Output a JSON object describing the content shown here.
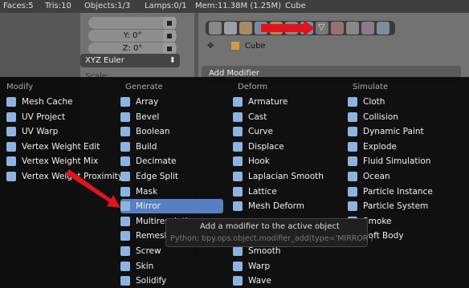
{
  "header": {
    "faces": "Faces:5",
    "tris": "Tris:10",
    "objects": "Objects:1/3",
    "lamps": "Lamps:0/1",
    "mem": "Mem:11.38M (1.25M)",
    "object_name": "Cube"
  },
  "transform": {
    "rot_y": "Y: 0°",
    "rot_z": "Z: 0°",
    "rotation_mode": "XYZ Euler",
    "scale_label": "Scale:"
  },
  "properties": {
    "breadcrumb_object": "Cube",
    "add_modifier_label": "Add Modifier"
  },
  "menu": {
    "columns": [
      {
        "header": "Modify",
        "items": [
          {
            "label": "Mesh Cache",
            "icon": "mesh-cache-icon",
            "color": "#8fb3e0"
          },
          {
            "label": "UV Project",
            "icon": "uv-project-icon",
            "color": "#8fb3e0"
          },
          {
            "label": "UV Warp",
            "icon": "uv-warp-icon",
            "color": "#8fb3e0"
          },
          {
            "label": "Vertex Weight Edit",
            "icon": "vertex-weight-edit-icon",
            "color": "#8fb3e0"
          },
          {
            "label": "Vertex Weight Mix",
            "icon": "vertex-weight-mix-icon",
            "color": "#8fb3e0"
          },
          {
            "label": "Vertex Weight Proximity",
            "icon": "vertex-weight-proximity-icon",
            "color": "#8fb3e0"
          }
        ]
      },
      {
        "header": "Generate",
        "items": [
          {
            "label": "Array",
            "icon": "array-icon",
            "color": "#8fb3e0"
          },
          {
            "label": "Bevel",
            "icon": "bevel-icon",
            "color": "#8fb3e0"
          },
          {
            "label": "Boolean",
            "icon": "boolean-icon",
            "color": "#8fb3e0"
          },
          {
            "label": "Build",
            "icon": "build-icon",
            "color": "#8fb3e0"
          },
          {
            "label": "Decimate",
            "icon": "decimate-icon",
            "color": "#8fb3e0"
          },
          {
            "label": "Edge Split",
            "icon": "edge-split-icon",
            "color": "#8fb3e0"
          },
          {
            "label": "Mask",
            "icon": "mask-icon",
            "color": "#8fb3e0"
          },
          {
            "label": "Mirror",
            "icon": "mirror-icon",
            "color": "#8fb3e0",
            "selected": true
          },
          {
            "label": "Multiresolution",
            "icon": "multiresolution-icon",
            "color": "#8fb3e0"
          },
          {
            "label": "Remesh",
            "icon": "remesh-icon",
            "color": "#8fb3e0"
          },
          {
            "label": "Screw",
            "icon": "screw-icon",
            "color": "#8fb3e0"
          },
          {
            "label": "Skin",
            "icon": "skin-icon",
            "color": "#8fb3e0"
          },
          {
            "label": "Solidify",
            "icon": "solidify-icon",
            "color": "#8fb3e0"
          }
        ]
      },
      {
        "header": "Deform",
        "items": [
          {
            "label": "Armature",
            "icon": "armature-icon",
            "color": "#8fb3e0"
          },
          {
            "label": "Cast",
            "icon": "cast-icon",
            "color": "#8fb3e0"
          },
          {
            "label": "Curve",
            "icon": "curve-icon",
            "color": "#8fb3e0"
          },
          {
            "label": "Displace",
            "icon": "displace-icon",
            "color": "#8fb3e0"
          },
          {
            "label": "Hook",
            "icon": "hook-icon",
            "color": "#8fb3e0"
          },
          {
            "label": "Laplacian Smooth",
            "icon": "laplacian-smooth-icon",
            "color": "#8fb3e0"
          },
          {
            "label": "Lattice",
            "icon": "lattice-icon",
            "color": "#8fb3e0"
          },
          {
            "label": "Mesh Deform",
            "icon": "mesh-deform-icon",
            "color": "#8fb3e0"
          },
          {
            "label": "",
            "icon": "",
            "color": ""
          },
          {
            "label": "",
            "icon": "",
            "color": ""
          },
          {
            "label": "Smooth",
            "icon": "smooth-icon",
            "color": "#8fb3e0"
          },
          {
            "label": "Warp",
            "icon": "warp-icon",
            "color": "#8fb3e0"
          },
          {
            "label": "Wave",
            "icon": "wave-icon",
            "color": "#8fb3e0"
          }
        ]
      },
      {
        "header": "Simulate",
        "items": [
          {
            "label": "Cloth",
            "icon": "cloth-icon",
            "color": "#8fb3e0"
          },
          {
            "label": "Collision",
            "icon": "collision-icon",
            "color": "#8fb3e0"
          },
          {
            "label": "Dynamic Paint",
            "icon": "dynamic-paint-icon",
            "color": "#8fb3e0"
          },
          {
            "label": "Explode",
            "icon": "explode-icon",
            "color": "#8fb3e0"
          },
          {
            "label": "Fluid Simulation",
            "icon": "fluid-simulation-icon",
            "color": "#8fb3e0"
          },
          {
            "label": "Ocean",
            "icon": "ocean-icon",
            "color": "#8fb3e0"
          },
          {
            "label": "Particle Instance",
            "icon": "particle-instance-icon",
            "color": "#8fb3e0"
          },
          {
            "label": "Particle System",
            "icon": "particle-system-icon",
            "color": "#8fb3e0"
          },
          {
            "label": "Smoke",
            "icon": "smoke-icon",
            "color": "#8fb3e0"
          },
          {
            "label": "Soft Body",
            "icon": "soft-body-icon",
            "color": "#8fb3e0"
          }
        ]
      }
    ]
  },
  "tooltip": {
    "title": "Add a modifier to the active object",
    "python": "Python: bpy.ops.object.modifier_add(type='MIRROR')"
  },
  "annotations": {
    "arrow_color": "#e0141e"
  }
}
